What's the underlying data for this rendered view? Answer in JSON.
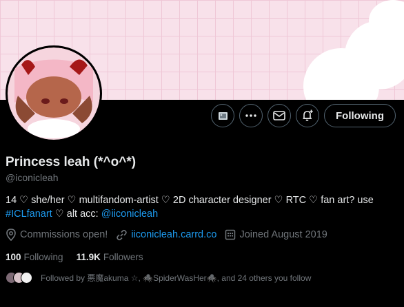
{
  "profile": {
    "display_name": "Princess leah (*^o^*)",
    "handle": "@iconicleah",
    "bio_text_1": "14 ♡ she/her ♡ multifandom-artist ♡ 2D character designer ♡ RTC ♡ fan art? use ",
    "bio_hashtag": "#ICLfanart",
    "bio_text_2": " ♡ alt acc: ",
    "bio_mention": "@iiconicleah"
  },
  "meta": {
    "location": "Commissions open!",
    "website": "iiconicleah.carrd.co",
    "joined": "Joined August 2019"
  },
  "counts": {
    "following_value": "100",
    "following_label": "Following",
    "followers_value": "11.9K",
    "followers_label": "Followers"
  },
  "followed_by": "Followed by 悪魔akuma ☆, 🕷️SpiderWasHer🕷️, and 24 others you follow",
  "actions": {
    "following_label": "Following"
  },
  "colors": {
    "accent": "#1d9bf0",
    "banner": "#f8e1ea"
  },
  "icons": [
    "image-icon",
    "more-icon",
    "mail-icon",
    "bell-plus-icon",
    "location-icon",
    "link-icon",
    "calendar-icon"
  ]
}
